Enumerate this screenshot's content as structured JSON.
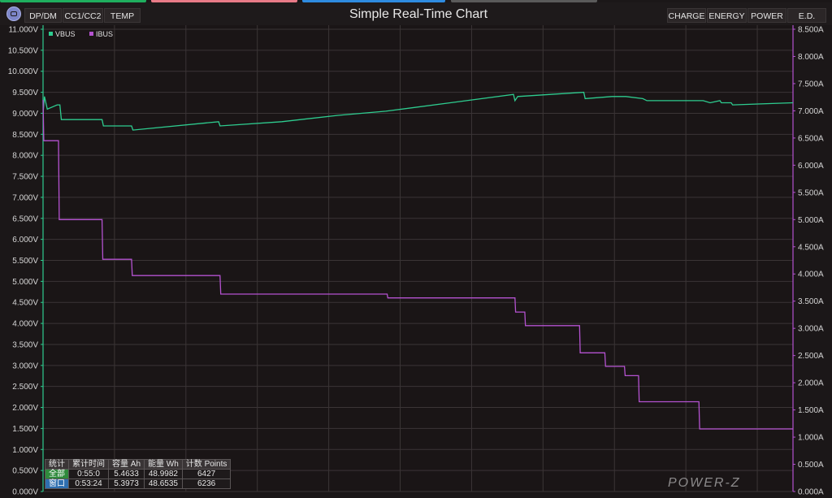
{
  "top_tabs_colors": [
    "#1fae5e",
    "#e87a87",
    "#2e8be0",
    "#5a5a5a"
  ],
  "toolbar": {
    "left_buttons": [
      "DP/DM",
      "CC1/CC2",
      "TEMP"
    ],
    "right_buttons": [
      "CHARGE",
      "ENERGY",
      "POWER",
      "E.D."
    ]
  },
  "chart_title": "Simple Real-Time Chart",
  "watermark": "POWER-Z",
  "chart_data": {
    "type": "line",
    "title": "Simple Real-Time Chart",
    "grid": true,
    "legend": "top-left",
    "y_left": {
      "min": 0,
      "max": 11,
      "unit": "V",
      "ticks": [
        "0.000V",
        "0.500V",
        "1.000V",
        "1.500V",
        "2.000V",
        "2.500V",
        "3.000V",
        "3.500V",
        "4.000V",
        "4.500V",
        "5.000V",
        "5.500V",
        "6.000V",
        "6.500V",
        "7.000V",
        "7.500V",
        "8.000V",
        "8.500V",
        "9.000V",
        "9.500V",
        "10.000V",
        "10.500V",
        "11.000V"
      ]
    },
    "y_right": {
      "min": 0,
      "max": 8.5,
      "unit": "A",
      "ticks": [
        "0.000A",
        "0.500A",
        "1.000A",
        "1.500A",
        "2.000A",
        "2.500A",
        "3.000A",
        "3.500A",
        "4.000A",
        "4.500A",
        "5.000A",
        "5.500A",
        "6.000A",
        "6.500A",
        "7.000A",
        "7.500A",
        "8.000A",
        "8.500A"
      ]
    },
    "x_range": [
      0,
      53.4
    ],
    "series": [
      {
        "name": "VBUS",
        "axis": "left",
        "color": "#2ecc8f",
        "points": [
          [
            0,
            9.0
          ],
          [
            0.1,
            9.4
          ],
          [
            0.3,
            9.1
          ],
          [
            1,
            9.2
          ],
          [
            1.2,
            9.2
          ],
          [
            1.3,
            8.85
          ],
          [
            4.2,
            8.85
          ],
          [
            4.3,
            8.7
          ],
          [
            6.3,
            8.7
          ],
          [
            6.4,
            8.6
          ],
          [
            12.5,
            8.8
          ],
          [
            12.6,
            8.7
          ],
          [
            17,
            8.8
          ],
          [
            21,
            8.95
          ],
          [
            24.4,
            9.05
          ],
          [
            29,
            9.25
          ],
          [
            33.5,
            9.45
          ],
          [
            33.6,
            9.3
          ],
          [
            33.8,
            9.4
          ],
          [
            38.5,
            9.5
          ],
          [
            38.6,
            9.35
          ],
          [
            40.5,
            9.4
          ],
          [
            41.5,
            9.4
          ],
          [
            42.7,
            9.35
          ],
          [
            43,
            9.3
          ],
          [
            47,
            9.3
          ],
          [
            47.5,
            9.25
          ],
          [
            48.2,
            9.3
          ],
          [
            48.3,
            9.25
          ],
          [
            49,
            9.25
          ],
          [
            49.1,
            9.2
          ],
          [
            53.4,
            9.25
          ]
        ]
      },
      {
        "name": "IBUS",
        "axis": "right",
        "color": "#b452d0",
        "points": [
          [
            0,
            7.2
          ],
          [
            0.05,
            6.45
          ],
          [
            1.1,
            6.45
          ],
          [
            1.15,
            5.0
          ],
          [
            4.2,
            5.0
          ],
          [
            4.25,
            4.27
          ],
          [
            6.3,
            4.27
          ],
          [
            6.35,
            3.97
          ],
          [
            12.6,
            3.97
          ],
          [
            12.65,
            3.63
          ],
          [
            24.5,
            3.63
          ],
          [
            24.55,
            3.56
          ],
          [
            33.6,
            3.56
          ],
          [
            33.65,
            3.3
          ],
          [
            34.3,
            3.3
          ],
          [
            34.35,
            3.05
          ],
          [
            38.2,
            3.05
          ],
          [
            38.25,
            2.55
          ],
          [
            40,
            2.55
          ],
          [
            40.05,
            2.3
          ],
          [
            41.4,
            2.3
          ],
          [
            41.45,
            2.13
          ],
          [
            42.4,
            2.13
          ],
          [
            42.45,
            1.65
          ],
          [
            46.7,
            1.65
          ],
          [
            46.75,
            1.15
          ],
          [
            53.4,
            1.15
          ]
        ]
      }
    ]
  },
  "stats": {
    "headers": [
      "统计",
      "累计时间",
      "容量 Ah",
      "能量 Wh",
      "计数 Points"
    ],
    "rows": [
      [
        "全部",
        "0:55:0",
        "5.4633",
        "48.9982",
        "6427"
      ],
      [
        "窗口",
        "0:53:24",
        "5.3973",
        "48.6535",
        "6236"
      ]
    ]
  }
}
